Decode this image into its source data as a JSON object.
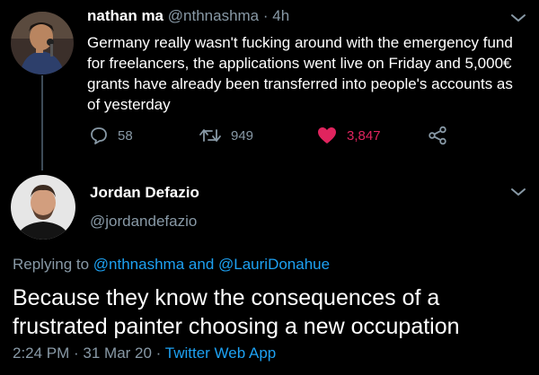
{
  "tweet": {
    "author_name": "nathan ma",
    "author_handle": "@nthnashma",
    "separator": "·",
    "time": "4h",
    "text": "Germany really wasn't fucking around with the emergency fund for freelancers, the applications went live on Friday and 5,000€ grants have already been transferred into people's accounts as of yesterday",
    "actions": {
      "reply_count": "58",
      "retweet_count": "949",
      "like_count": "3,847",
      "like_color": "#e0245e"
    }
  },
  "reply": {
    "author_name": "Jordan Defazio",
    "author_handle": "@jordandefazio",
    "replying_prefix": "Replying to",
    "mention_1": "@nthnashma",
    "conjunction": "and",
    "mention_2": "@LauriDonahue",
    "text": "Because they know the consequences of a frustrated painter choosing a new occupation",
    "timestamp": "2:24 PM · 31 Mar 20 ·",
    "source": "Twitter Web App"
  },
  "colors": {
    "background": "#000000",
    "muted_text": "#8899a6",
    "link": "#1da1f2"
  },
  "icons": {
    "reply": "speech-bubble-icon",
    "retweet": "retweet-arrows-icon",
    "like": "heart-icon",
    "share": "share-icon",
    "menu": "chevron-down-icon"
  }
}
